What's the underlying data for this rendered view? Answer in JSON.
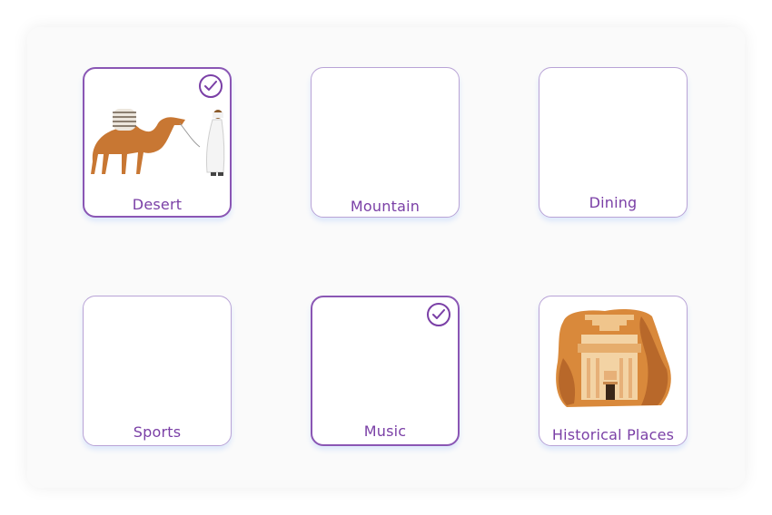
{
  "categories": [
    {
      "label": "Desert",
      "selected": true
    },
    {
      "label": "Mountain",
      "selected": false
    },
    {
      "label": "Dining",
      "selected": false
    },
    {
      "label": "Sports",
      "selected": false
    },
    {
      "label": "Music",
      "selected": true
    },
    {
      "label": "Historical Places",
      "selected": false
    }
  ],
  "icons": {
    "check": "checkmark-icon",
    "desert": "camel-icon",
    "historical": "rock-tomb-icon"
  },
  "colors": {
    "accent": "#7a3fa6",
    "card_border": "#b9a3d6",
    "panel_bg": "#fafafa"
  }
}
